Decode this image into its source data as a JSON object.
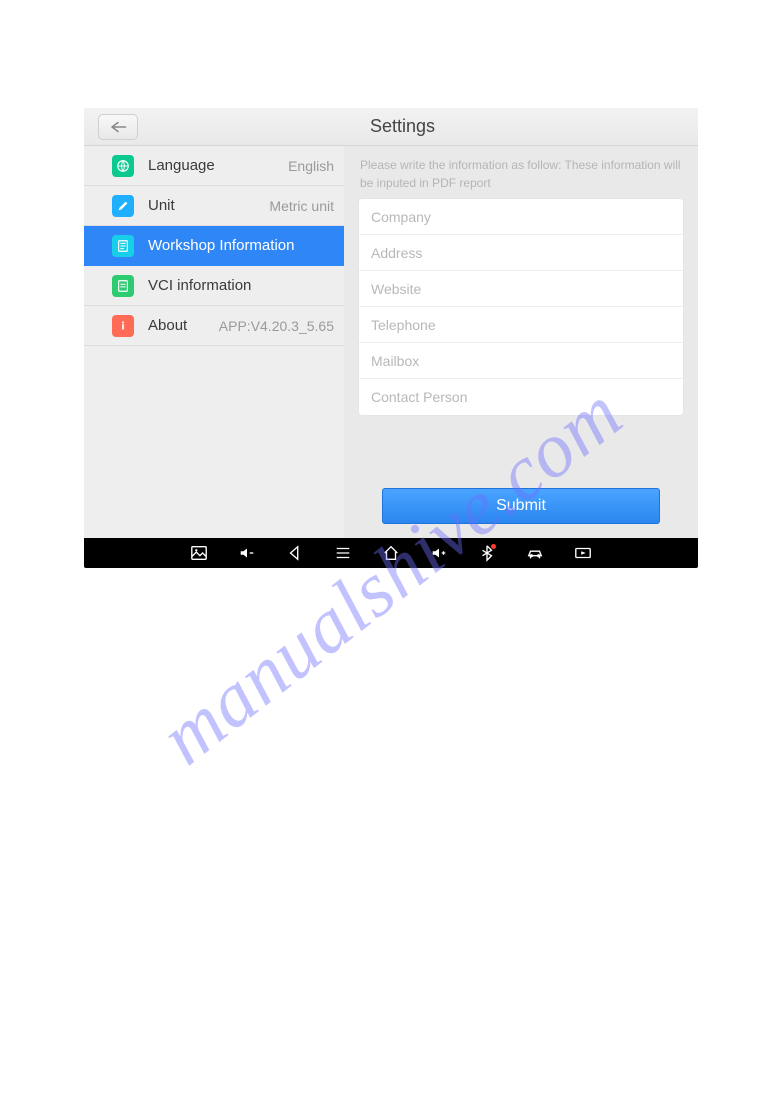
{
  "header": {
    "title": "Settings"
  },
  "sidebar": {
    "items": [
      {
        "label": "Language",
        "value": "English",
        "icon": "globe-icon",
        "iconClass": "ic-green"
      },
      {
        "label": "Unit",
        "value": "Metric unit",
        "icon": "pencil-icon",
        "iconClass": "ic-blue"
      },
      {
        "label": "Workshop Information",
        "value": "",
        "icon": "form-icon",
        "iconClass": "ic-blue2",
        "active": true
      },
      {
        "label": "VCI information",
        "value": "",
        "icon": "doc-icon",
        "iconClass": "ic-green2"
      },
      {
        "label": "About",
        "value": "APP:V4.20.3_5.65",
        "icon": "info-icon",
        "iconClass": "ic-red"
      }
    ]
  },
  "main": {
    "hint": "Please write the information as follow: These information will be inputed in PDF report",
    "fields": {
      "company": {
        "placeholder": "Company"
      },
      "address": {
        "placeholder": "Address"
      },
      "website": {
        "placeholder": "Website"
      },
      "telephone": {
        "placeholder": "Telephone"
      },
      "mailbox": {
        "placeholder": "Mailbox"
      },
      "contact_person": {
        "placeholder": "Contact Person"
      }
    },
    "submit_label": "Submit"
  },
  "watermark": "manualshive.com"
}
